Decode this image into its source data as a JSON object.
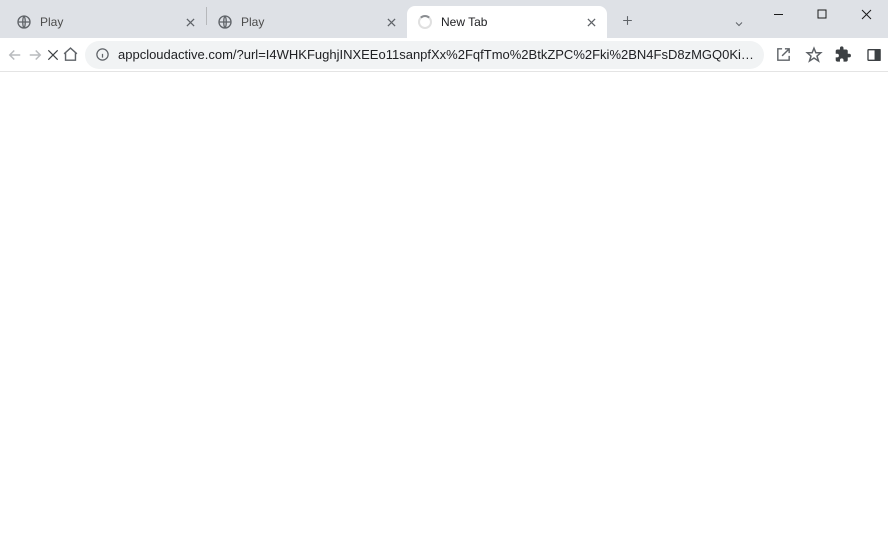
{
  "tabs": [
    {
      "title": "Play",
      "active": false
    },
    {
      "title": "Play",
      "active": false
    },
    {
      "title": "New Tab",
      "active": true
    }
  ],
  "omnibox": {
    "url": "appcloudactive.com/?url=I4WHKFughjINXEEo11sanpfXx%2FqfTmo%2BtkZPC%2Fki%2BN4FsD8zMGQ0Ki…"
  }
}
